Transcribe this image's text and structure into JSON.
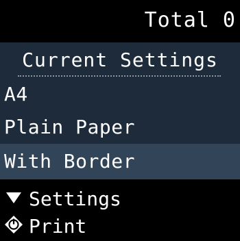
{
  "header": {
    "total_label": "Total 0"
  },
  "settings_panel": {
    "title": "Current Settings",
    "items": [
      {
        "label": "A4"
      },
      {
        "label": "Plain Paper"
      },
      {
        "label": "With Border"
      }
    ]
  },
  "hints": {
    "settings_label": "Settings",
    "settings_icon": "down-triangle-icon",
    "print_label": "Print",
    "print_icon": "start-diamond-icon"
  },
  "colors": {
    "background": "#000000",
    "panel": "#1d2b3a",
    "selected_row": "#314458",
    "text": "#ffffff"
  }
}
